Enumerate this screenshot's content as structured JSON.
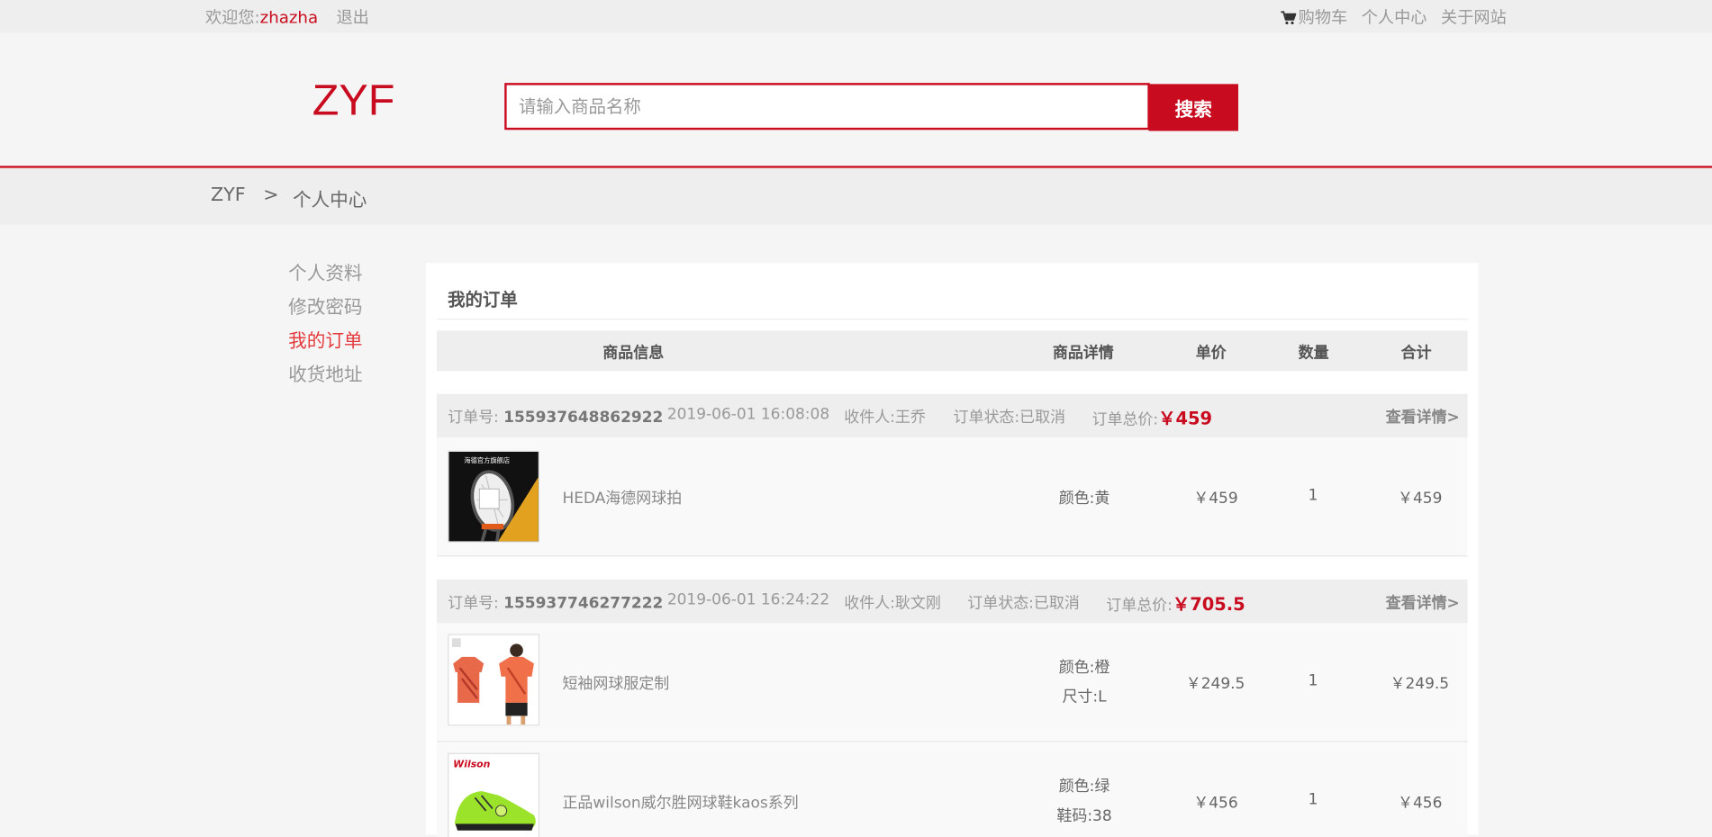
{
  "topbar": {
    "welcome": "欢迎您:",
    "username": "zhazha",
    "logout": "退出",
    "cart": "购物车",
    "profile": "个人中心",
    "about": "关于网站"
  },
  "header": {
    "logo": "ZYF",
    "search_placeholder": "请输入商品名称",
    "search_button": "搜索"
  },
  "breadcrumb": {
    "home": "ZYF",
    "separator": ">",
    "current": "个人中心"
  },
  "sidebar": {
    "items": [
      {
        "label": "个人资料",
        "active": false
      },
      {
        "label": "修改密码",
        "active": false
      },
      {
        "label": "我的订单",
        "active": true
      },
      {
        "label": "收货地址",
        "active": false
      }
    ]
  },
  "orders_panel": {
    "title": "我的订单",
    "columns": [
      "商品信息",
      "商品详情",
      "单价",
      "数量",
      "合计"
    ],
    "orders": [
      {
        "number_label": "订单号:",
        "number": "155937648862922",
        "datetime": "2019-06-01 16:08:08",
        "receiver": "收件人:王乔",
        "status": "订单状态:已取消",
        "total_label": "订单总价:",
        "total": "￥459",
        "detail_link": "查看详情>",
        "items": [
          {
            "name": "HEDA海德网球拍",
            "attrs": [
              "颜色:黄"
            ],
            "price": "￥459",
            "qty": "1",
            "subtotal": "￥459",
            "image": "tennis-racket"
          }
        ]
      },
      {
        "number_label": "订单号:",
        "number": "155937746277222",
        "datetime": "2019-06-01 16:24:22",
        "receiver": "收件人:耿文刚",
        "status": "订单状态:已取消",
        "total_label": "订单总价:",
        "total": "￥705.5",
        "detail_link": "查看详情>",
        "items": [
          {
            "name": "短袖网球服定制",
            "attrs": [
              "颜色:橙",
              "尺寸:L"
            ],
            "price": "￥249.5",
            "qty": "1",
            "subtotal": "￥249.5",
            "image": "tennis-shirt"
          },
          {
            "name": "正品wilson威尔胜网球鞋kaos系列",
            "attrs": [
              "颜色:绿",
              "鞋码:38"
            ],
            "price": "￥456",
            "qty": "1",
            "subtotal": "￥456",
            "image": "tennis-shoe"
          }
        ]
      }
    ]
  },
  "colors": {
    "brand_red": "#c80b1e",
    "active_red": "#e4393c"
  },
  "image_text": {
    "racket_banner": "海德官方旗舰店",
    "shoe_brand": "Wilson"
  }
}
